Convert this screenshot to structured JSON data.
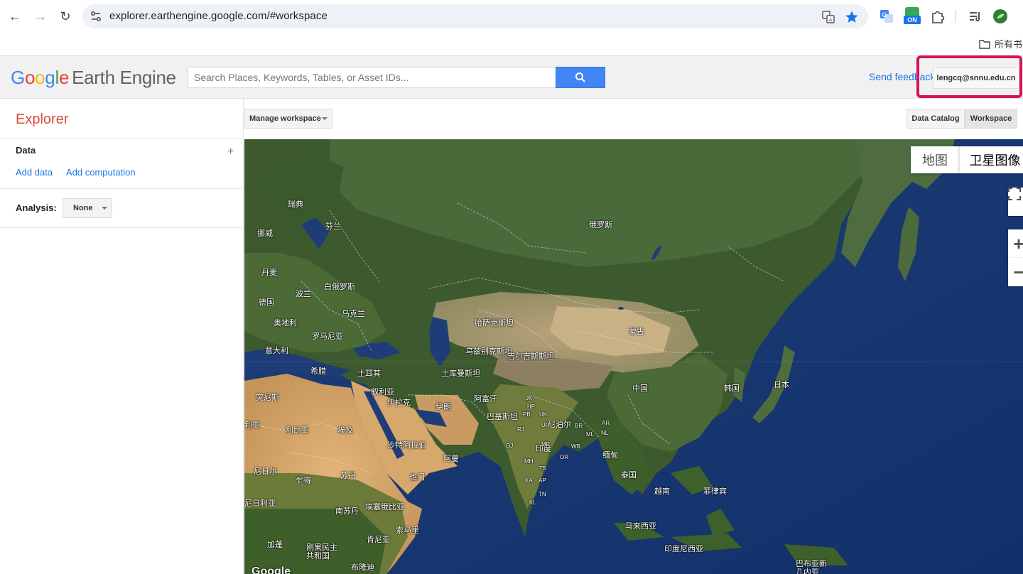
{
  "browser": {
    "url": "explorer.earthengine.google.com/#workspace",
    "bookmark_folder": "所有书签",
    "ext_badge": "ON"
  },
  "header": {
    "logo_google": "Google",
    "logo_product": "Earth Engine",
    "search_placeholder": "Search Places, Keywords, Tables, or Asset IDs...",
    "send_feedback": "Send feedback",
    "account": "lengcq@snnu.edu.cn"
  },
  "left_panel": {
    "title": "Explorer",
    "data_heading": "Data",
    "add_data": "Add data",
    "add_computation": "Add computation",
    "analysis_label": "Analysis:",
    "analysis_value": "None"
  },
  "toolbar": {
    "manage_workspace": "Manage workspace",
    "data_catalog": "Data Catalog",
    "workspace": "Workspace"
  },
  "map": {
    "map_type_map": "地图",
    "map_type_satellite": "卫星图像",
    "zoom_in": "+",
    "zoom_out": "−",
    "labels": {
      "sweden": "瑞典",
      "norway": "挪威",
      "finland": "芬兰",
      "russia": "俄罗斯",
      "denmark": "丹麦",
      "poland": "波兰",
      "belarus": "白俄罗斯",
      "germany": "德国",
      "ukraine": "乌克兰",
      "austria": "奥地利",
      "romania": "罗马尼亚",
      "italy": "意大利",
      "greece": "希腊",
      "turkey": "土耳其",
      "kazakhstan": "哈萨克斯坦",
      "mongolia": "蒙古",
      "uzbekistan": "乌兹别克斯坦",
      "kyrgyzstan": "吉尔吉斯斯坦",
      "turkmenistan": "土库曼斯坦",
      "china": "中国",
      "korea": "韩国",
      "japan": "日本",
      "tunisia": "突尼斯",
      "syria": "叙利亚",
      "iran": "伊朗",
      "afghanistan": "阿富汗",
      "iraq": "伊拉克",
      "algeria": "利亚",
      "libya": "利比亚",
      "egypt": "埃及",
      "pakistan": "巴基斯坦",
      "nepal": "尼泊尔",
      "saudi": "沙特阿拉伯",
      "oman": "阿曼",
      "india": "印度",
      "myanmar": "缅甸",
      "thailand": "泰国",
      "vietnam": "越南",
      "philippines": "菲律宾",
      "niger": "尼日尔",
      "chad": "乍得",
      "sudan": "苏丹",
      "yemen": "也门",
      "nigeria": "尼日利亚",
      "south_sudan": "南苏丹",
      "ethiopia": "埃塞俄比亚",
      "somalia": "索马里",
      "kenya": "肯尼亚",
      "gabon": "加蓬",
      "drc": "刚果民主\n共和国",
      "burundi": "布隆迪",
      "malaysia": "马来西亚",
      "indonesia": "印度尼西亚",
      "png": "巴布亚新\n几内亚",
      "s_jk": "JK",
      "s_hp": "HP",
      "s_pb": "PB",
      "s_uk": "UK",
      "s_up": "UP",
      "s_br": "BR",
      "s_ml": "ML",
      "s_nl": "NL",
      "s_ar": "AR",
      "s_rj": "RJ",
      "s_gj": "GJ",
      "s_mp": "MP",
      "s_wb": "WB",
      "s_mh": "MH",
      "s_ts": "TS",
      "s_or": "OR",
      "s_ka": "KA",
      "s_ap": "AP",
      "s_tn": "TN",
      "s_kl": "KL",
      "google": "Google"
    }
  }
}
